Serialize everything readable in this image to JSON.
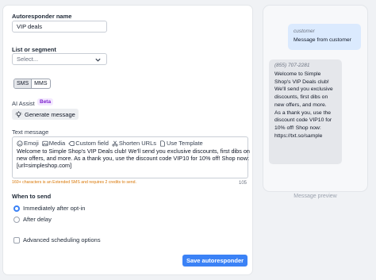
{
  "form": {
    "name_label": "Autoresponder name",
    "name_value": "VIP deals",
    "list_label": "List or segment",
    "list_placeholder": "Select...",
    "channel": {
      "options": [
        "SMS",
        "MMS"
      ],
      "selected": "SMS"
    },
    "ai_label": "AI Assist",
    "ai_badge": "Beta",
    "generate_label": "Generate message",
    "text_label": "Text message",
    "toolbar": {
      "emoji": "Emoji",
      "media": "Media",
      "custom_field": "Custom field",
      "shorten": "Shorten URLs",
      "template": "Use Template"
    },
    "message": "Welcome to Simple Shop's VIP Deals club! We'll send you exclusive discounts, first dibs on new offers, and more. As a thank you, use the discount code VIP10 for 10% off! Shop now: [url=simpleshop.com]",
    "char_count": "105",
    "warning": "160+ characters is an Extended SMS and requires 2 credits to send.",
    "when_label": "When to send",
    "when_options": [
      "Immediately after opt-in",
      "After delay"
    ],
    "when_selected": 0,
    "advanced_label": "Advanced scheduling options",
    "save_label": "Save autoresponder"
  },
  "preview": {
    "customer_label": "customer",
    "customer_message": "Message from customer",
    "sender": "(855) 707-2281",
    "reply_lines": [
      "Welcome to Simple",
      "Shop's VIP Deals club!",
      "We'll send you exclusive",
      "discounts, first dibs on",
      "new offers, and more.",
      "As a thank you, use the",
      "discount code VIP10 for",
      "10% off! Shop now:",
      "https://txt.so/sample"
    ],
    "caption": "Message preview"
  },
  "colors": {
    "accent": "#3b82f6",
    "beta_text": "#7e22ce",
    "beta_bg": "#f3e8ff",
    "warning": "#d97706",
    "outgoing_bubble": "#dbeafe",
    "incoming_bubble": "#e5e7eb"
  }
}
